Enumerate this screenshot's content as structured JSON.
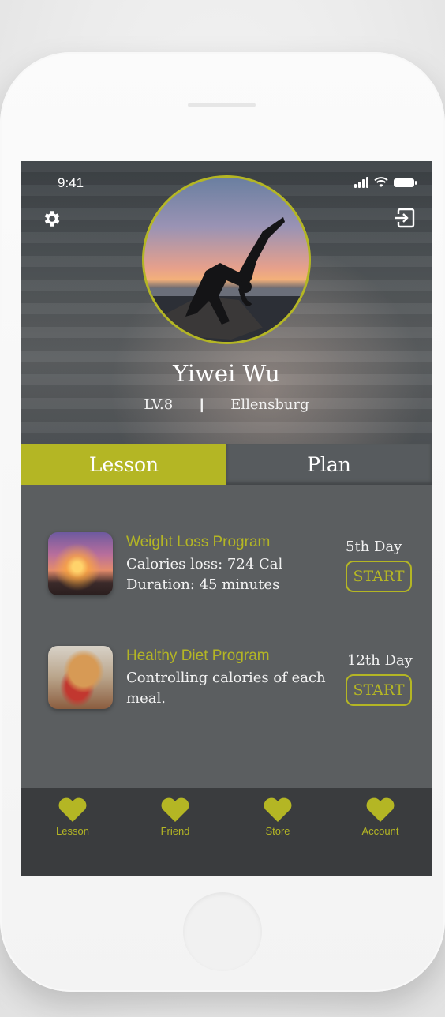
{
  "status_bar": {
    "time": "9:41"
  },
  "header": {
    "settings_icon": "gear-icon",
    "logout_icon": "logout-icon",
    "user_name": "Yiwei Wu",
    "level": "LV.8",
    "separator": "|",
    "location": "Ellensburg"
  },
  "tabs": [
    {
      "label": "Lesson",
      "active": true
    },
    {
      "label": "Plan",
      "active": false
    }
  ],
  "programs": [
    {
      "title": "Weight Loss Program",
      "line1": "Calories loss: 724 Cal",
      "line2": "Duration: 45 minutes",
      "day": "5th Day",
      "button": "START",
      "thumb": "beach-sunset-image"
    },
    {
      "title": "Healthy Diet Program",
      "line1": "Controlling calories of each meal.",
      "day": "12th Day",
      "button": "START",
      "thumb": "sandwich-image"
    }
  ],
  "bottom_nav": [
    {
      "label": "Lesson",
      "icon": "heart-icon"
    },
    {
      "label": "Friend",
      "icon": "heart-icon"
    },
    {
      "label": "Store",
      "icon": "heart-icon"
    },
    {
      "label": "Account",
      "icon": "heart-icon"
    }
  ],
  "colors": {
    "accent": "#b4b624",
    "screen_bg": "#5b5e60",
    "nav_bg": "#3a3c3e"
  }
}
